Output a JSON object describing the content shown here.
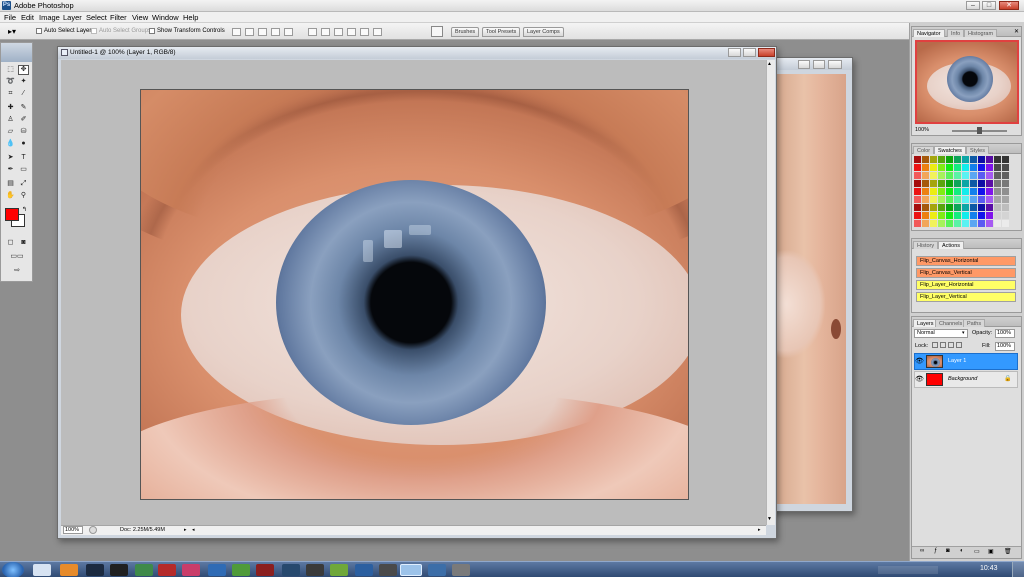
{
  "window": {
    "title": "Adobe Photoshop",
    "min": "–",
    "max": "□",
    "close": "✕"
  },
  "menu": [
    "File",
    "Edit",
    "Image",
    "Layer",
    "Select",
    "Filter",
    "View",
    "Window",
    "Help"
  ],
  "options": {
    "auto_select_layer": "Auto Select Layer",
    "auto_select_groups": "Auto Select Groups",
    "show_transform_controls": "Show Transform Controls",
    "wells": [
      "Brushes",
      "Tool Presets",
      "Layer Comps"
    ]
  },
  "document": {
    "title": "Untitled-1 @ 100% (Layer 1, RGB/8)",
    "zoom": "100%",
    "doc_size": "Doc: 2.25M/5.49M"
  },
  "navigator": {
    "tabs": [
      "Navigator",
      "Info",
      "Histogram"
    ],
    "zoom": "100%"
  },
  "swatches": {
    "tabs": [
      "Color",
      "Swatches",
      "Styles"
    ]
  },
  "actions": {
    "tabs": [
      "History",
      "Actions"
    ],
    "items": [
      "Flip_Canvas_Horizontal",
      "Flip_Canvas_Vertical",
      "Flip_Layer_Horizontal",
      "Flip_Layer_Vertical"
    ]
  },
  "layers": {
    "tabs": [
      "Layers",
      "Channels",
      "Paths"
    ],
    "blend_mode": "Normal",
    "opacity_label": "Opacity:",
    "opacity": "100%",
    "lock_label": "Lock:",
    "fill_label": "Fill:",
    "fill": "100%",
    "items": [
      {
        "name": "Layer 1",
        "selected": true
      },
      {
        "name": "Background",
        "selected": false
      }
    ]
  },
  "taskbar": {
    "clock": "10:43"
  },
  "colors": {
    "foreground": "#ff0000",
    "background": "#ffffff",
    "accent_selected_layer": "#3399ff",
    "action_orange": "#ff9966",
    "action_yellow": "#ffff66"
  }
}
